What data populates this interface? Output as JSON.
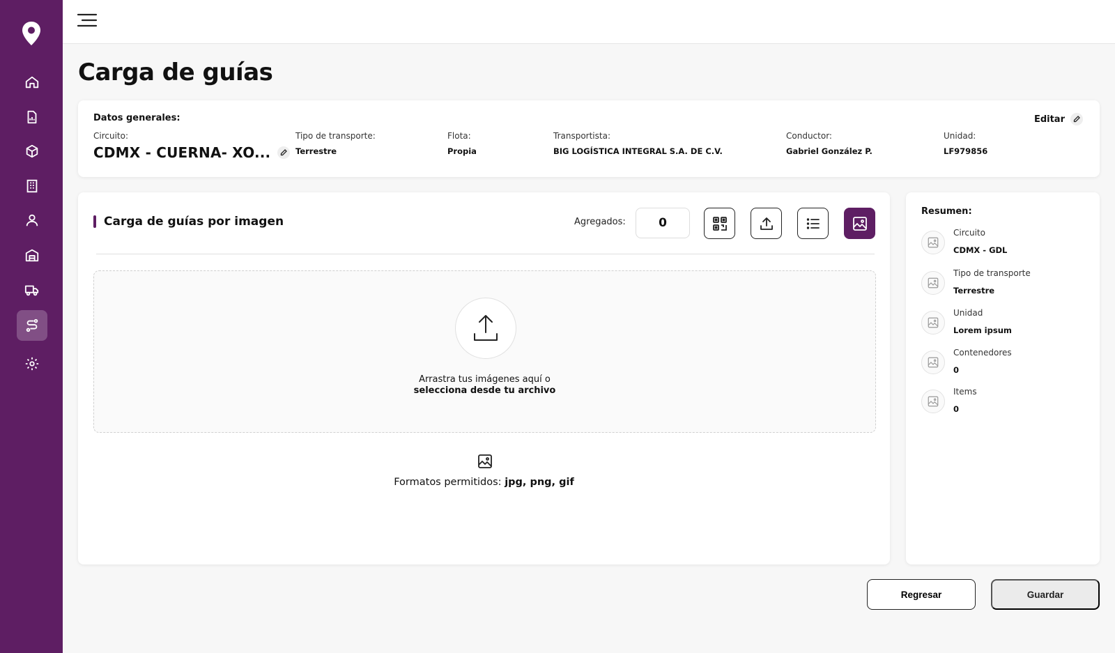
{
  "page": {
    "title": "Carga de guías"
  },
  "sidebar": {
    "logo": "location-pin-icon",
    "items": [
      {
        "icon": "home-icon",
        "active": false
      },
      {
        "icon": "report-icon",
        "active": false
      },
      {
        "icon": "package-icon",
        "active": false
      },
      {
        "icon": "building-icon",
        "active": false
      },
      {
        "icon": "user-icon",
        "active": false
      },
      {
        "icon": "warehouse-icon",
        "active": false
      },
      {
        "icon": "truck-icon",
        "active": false
      },
      {
        "icon": "route-icon",
        "active": true
      },
      {
        "icon": "settings-icon",
        "active": false
      }
    ]
  },
  "general": {
    "heading": "Datos generales:",
    "edit_label": "Editar",
    "circuit_label": "Circuito:",
    "circuit_value": "CDMX - CUERNA- XO...",
    "transport_label": "Tipo de transporte:",
    "transport_value": "Terrestre",
    "fleet_label": "Flota:",
    "fleet_value": "Propia",
    "carrier_label": "Transportista:",
    "carrier_value": "BIG LOGÍSTICA INTEGRAL S.A. DE C.V.",
    "driver_label": "Conductor:",
    "driver_value": "Gabriel González P.",
    "unit_label": "Unidad:",
    "unit_value": "LF979856"
  },
  "upload": {
    "title": "Carga de guías por imagen",
    "added_label": "Agregados:",
    "added_count": "0",
    "tools": [
      {
        "icon": "qr-code-icon",
        "active": false
      },
      {
        "icon": "upload-icon",
        "active": false
      },
      {
        "icon": "list-icon",
        "active": false
      },
      {
        "icon": "image-icon",
        "active": true
      }
    ],
    "drop_text_line1": "Arrastra tus imágenes aquí o",
    "drop_text_line2": "selecciona desde tu archivo",
    "formats_label": "Formatos permitidos:",
    "formats_value": "jpg, png, gif"
  },
  "summary": {
    "heading": "Resumen:",
    "items": [
      {
        "label": "Circuito",
        "value": "CDMX - GDL"
      },
      {
        "label": "Tipo de transporte",
        "value": "Terrestre"
      },
      {
        "label": "Unidad",
        "value": "Lorem ipsum"
      },
      {
        "label": "Contenedores",
        "value": "0"
      },
      {
        "label": "Items",
        "value": "0"
      }
    ]
  },
  "footer": {
    "back_label": "Regresar",
    "save_label": "Guardar"
  },
  "colors": {
    "brand": "#5e1e63",
    "background": "#f7f7f7"
  }
}
